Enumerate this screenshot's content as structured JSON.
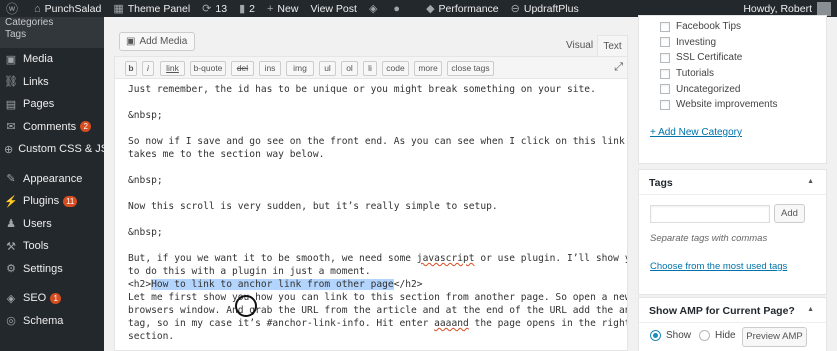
{
  "adminbar": {
    "site_name": "PunchSalad",
    "theme_panel": "Theme Panel",
    "updates_count": "13",
    "comments_count": "2",
    "new_label": "New",
    "view_post": "View Post",
    "performance": "Performance",
    "updraftplus": "UpdraftPlus",
    "howdy": "Howdy, Robert"
  },
  "sidebar": {
    "subitems": [
      "Categories",
      "Tags"
    ],
    "items": [
      {
        "label": "Media",
        "icon": "media-icon",
        "glyph": "▣"
      },
      {
        "label": "Links",
        "icon": "links-icon",
        "glyph": "⛓"
      },
      {
        "label": "Pages",
        "icon": "pages-icon",
        "glyph": "▤"
      },
      {
        "label": "Comments",
        "icon": "comments-icon",
        "glyph": "✉",
        "badge": "2"
      },
      {
        "label": "Custom CSS & JS",
        "icon": "plus-circle-icon",
        "glyph": "⊕"
      },
      {
        "label": "Appearance",
        "icon": "appearance-icon",
        "glyph": "✎"
      },
      {
        "label": "Plugins",
        "icon": "plugins-icon",
        "glyph": "⚡",
        "badge": "11"
      },
      {
        "label": "Users",
        "icon": "users-icon",
        "glyph": "♟"
      },
      {
        "label": "Tools",
        "icon": "tools-icon",
        "glyph": "⚒"
      },
      {
        "label": "Settings",
        "icon": "settings-icon",
        "glyph": "⚙"
      },
      {
        "label": "SEO",
        "icon": "seo-icon",
        "glyph": "◈",
        "badge": "1"
      },
      {
        "label": "Schema",
        "icon": "schema-icon",
        "glyph": "◎"
      }
    ]
  },
  "editor": {
    "add_media": "Add Media",
    "tab_visual": "Visual",
    "tab_text": "Text",
    "quicktags": [
      "b",
      "i",
      "link",
      "b-quote",
      "del",
      "ins",
      "img",
      "ul",
      "ol",
      "li",
      "code",
      "more",
      "close tags"
    ],
    "lines": [
      "Just remember, the id has to be unique or you might break something on your site.",
      "",
      "&nbsp;",
      "",
      "So now if I save and go see on the front end. As you can see when I click on this link. It",
      "takes me to the section way below.",
      "",
      "&nbsp;",
      "",
      "Now this scroll is very sudden, but it’s really simple to setup.",
      "",
      "&nbsp;",
      "",
      "But, if you we want it to be smooth, we need some javascript or use plugin. I’ll show you how",
      "to do this with a plugin in just a moment.",
      "<h2>How to link to anchor link from other page</h2>",
      "Let me first show you how you can link to this section from another page. So open a new",
      "browsers window. And grab the URL from the article and at the end of the URL add the anchor",
      "tag, so in my case it’s #anchor-link-info. Hit enter aaaand the page opens in the right",
      "section."
    ],
    "h2_open": "<h2>",
    "h2_selected": "How to link to anchor link from other page",
    "h2_close": "</h2>"
  },
  "categories": {
    "items": [
      "Facebook Tips",
      "Investing",
      "SSL Certificate",
      "Tutorials",
      "Uncategorized",
      "Website improvements"
    ],
    "add_link": "+ Add New Category"
  },
  "tags": {
    "title": "Tags",
    "add_button": "Add",
    "hint": "Separate tags with commas",
    "choose_link": "Choose from the most used tags"
  },
  "amp": {
    "title": "Show AMP for Current Page?",
    "show_label": "Show",
    "hide_label": "Hide",
    "preview_button": "Preview AMP"
  },
  "colors": {
    "adminbar_bg": "#23282d",
    "link_blue": "#0073aa",
    "badge_orange": "#d54e21",
    "selection": "#b3d4fc"
  }
}
